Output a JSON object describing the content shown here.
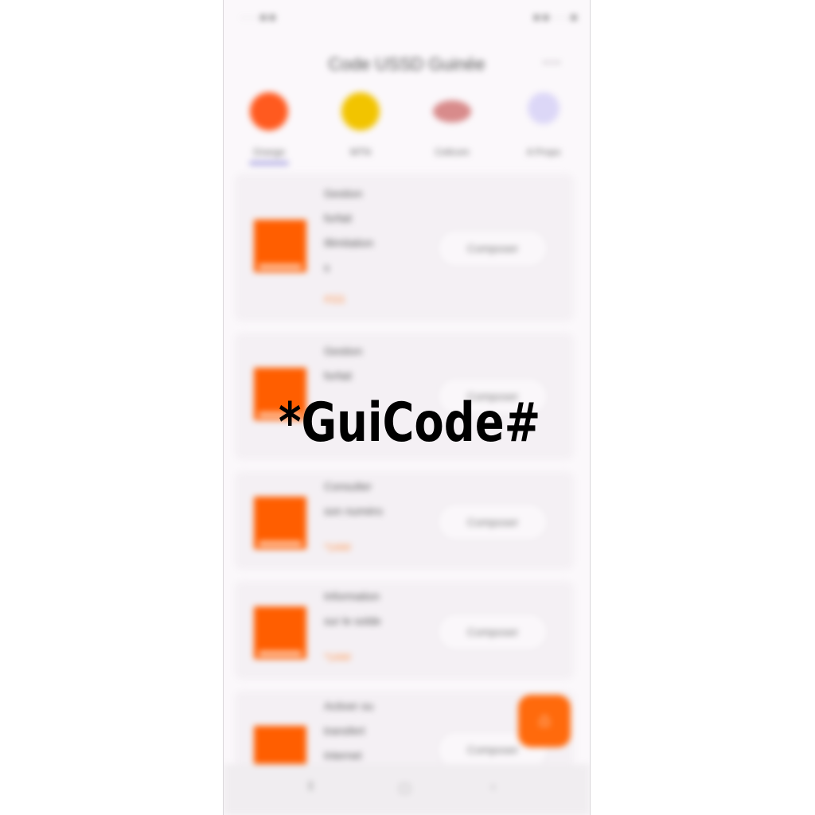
{
  "watermark": "*GuiCode#",
  "statusbar": {
    "left": "· · · ■ ■",
    "right": "■ ■ · · · ■"
  },
  "header": {
    "title": "Code USSD Guinée",
    "menu_icon": "more-icon"
  },
  "categories": [
    {
      "label": "Orange",
      "color": "#ff5a1f"
    },
    {
      "label": "MTN",
      "color": "#f2c400"
    },
    {
      "label": "Cellcom",
      "color": "#b54a4a"
    },
    {
      "label": "A Propo",
      "color": "#c9c3f5"
    }
  ],
  "cards": [
    {
      "name": "Gestion\nforfait\nIllimitation\ns",
      "price": "#111",
      "button": "Composer"
    },
    {
      "name": "Gestion\nforfait\n",
      "price": "",
      "button": "Composer"
    },
    {
      "name": "Consulter\nson numéro",
      "price": "*144#",
      "button": "Composer"
    },
    {
      "name": "Information\nsur le solde",
      "price": "*144#",
      "button": "Composer"
    },
    {
      "name": "Activer ou\ntransfert\nInternet",
      "price": "",
      "button": "Composer"
    }
  ],
  "colors": {
    "brand": "#ff5e00",
    "accent_fab": "#ff6a0c",
    "price": "#ff8a3c"
  },
  "navbar": {
    "recent": "‖",
    "home": "▢",
    "back": "‹"
  }
}
